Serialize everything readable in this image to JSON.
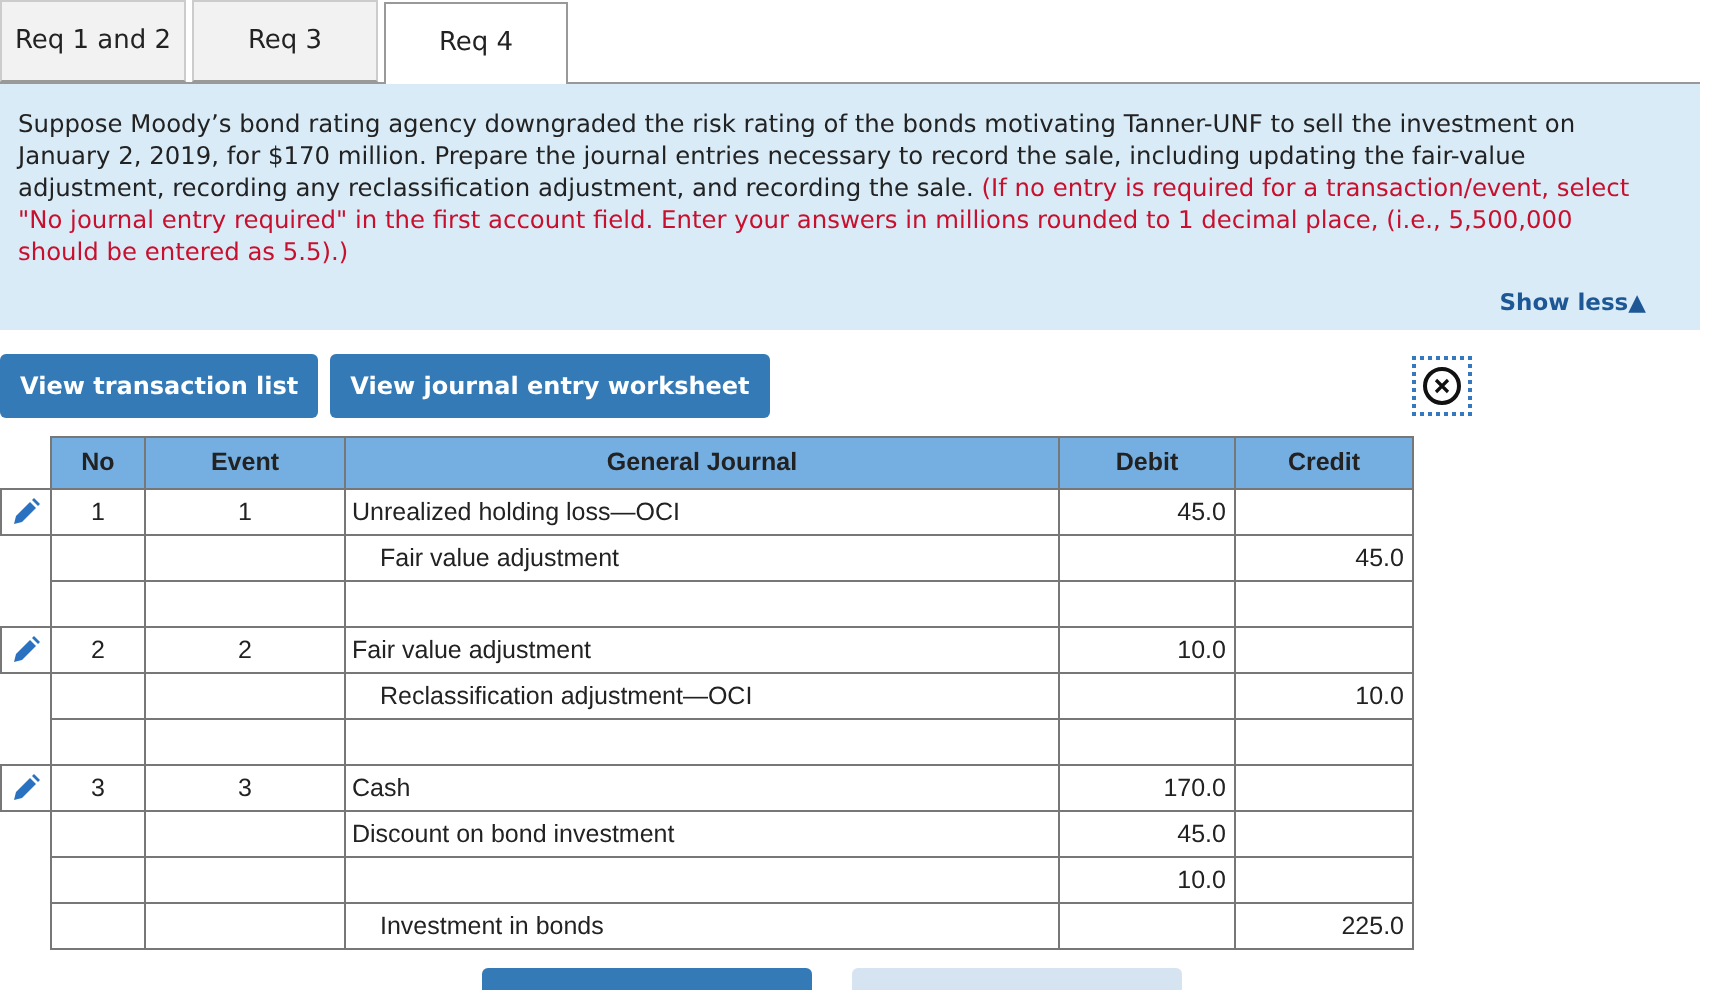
{
  "tabs": [
    {
      "label": "Req 1 and 2",
      "selected": false
    },
    {
      "label": "Req 3",
      "selected": false
    },
    {
      "label": "Req 4",
      "selected": true
    }
  ],
  "instructions": {
    "text": "Suppose Moody’s bond rating agency downgraded the risk rating of the bonds motivating Tanner-UNF to sell the investment on January 2, 2019, for $170 million. Prepare the journal entries necessary to record the sale, including updating the fair-value adjustment, recording any reclassification adjustment, and recording the sale.",
    "note": "(If no entry is required for a transaction/event, select \"No journal entry required\" in the first account field. Enter your answers in millions rounded to 1 decimal place, (i.e., 5,500,000 should be entered as 5.5).)",
    "toggle": "Show less▲"
  },
  "buttons": [
    "View transaction list",
    "View journal entry worksheet"
  ],
  "table": {
    "columns": [
      "No",
      "Event",
      "General Journal",
      "Debit",
      "Credit"
    ],
    "rows": [
      {
        "editable": true,
        "no": "1",
        "event": "1",
        "account": "Unrealized holding loss—OCI",
        "indent": false,
        "debit": "45.0"
      },
      {
        "editable": false,
        "account": "Fair value adjustment",
        "indent": true,
        "credit": "45.0"
      },
      {
        "editable": false
      },
      {
        "editable": true,
        "no": "2",
        "event": "2",
        "account": "Fair value adjustment",
        "indent": false,
        "debit": "10.0"
      },
      {
        "editable": false,
        "account": "Reclassification adjustment—OCI",
        "indent": true,
        "credit": "10.0"
      },
      {
        "editable": false
      },
      {
        "editable": true,
        "no": "3",
        "event": "3",
        "account": "Cash",
        "indent": false,
        "debit": "170.0"
      },
      {
        "editable": false,
        "account": "Discount on bond investment",
        "indent": false,
        "debit": "45.0"
      },
      {
        "editable": false,
        "debit": "10.0"
      },
      {
        "editable": false,
        "account": "Investment in bonds",
        "indent": true,
        "credit": "225.0"
      }
    ]
  }
}
